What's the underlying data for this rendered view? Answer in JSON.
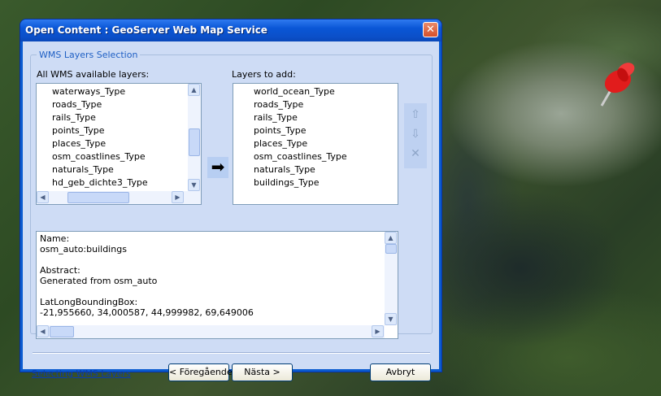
{
  "dialog": {
    "title": "Open Content : GeoServer Web Map Service",
    "close_label": "✕",
    "group_title": "WMS Layers Selection",
    "available_label": "All WMS available layers:",
    "add_label": "Layers to add:",
    "available_layers": [
      "waterways_Type",
      "roads_Type",
      "rails_Type",
      "points_Type",
      "places_Type",
      "osm_coastlines_Type",
      "naturals_Type",
      "hd_geb_dichte3_Type"
    ],
    "layers_to_add": [
      "world_ocean_Type",
      "roads_Type",
      "rails_Type",
      "points_Type",
      "places_Type",
      "osm_coastlines_Type",
      "naturals_Type",
      "buildings_Type"
    ],
    "add_arrow": "➡",
    "tools": {
      "up": "⇧",
      "down": "⇩",
      "remove": "✕"
    },
    "info_lines": [
      "Name:",
      "osm_auto:buildings",
      "",
      "Abstract:",
      "Generated from osm_auto",
      "",
      "LatLongBoundingBox:",
      "-21,955660, 34,000587, 44,999982, 69,649006"
    ],
    "help_link": "Selecting WMS Layers",
    "back_button": "< Föregående",
    "next_button": "Nästa >",
    "cancel_button": "Avbryt"
  },
  "colors": {
    "title_bar": "#0a56d6",
    "client": "#cedcf5",
    "accent": "#1e5fc4"
  },
  "icons": {
    "pin": "pushpin-icon"
  }
}
